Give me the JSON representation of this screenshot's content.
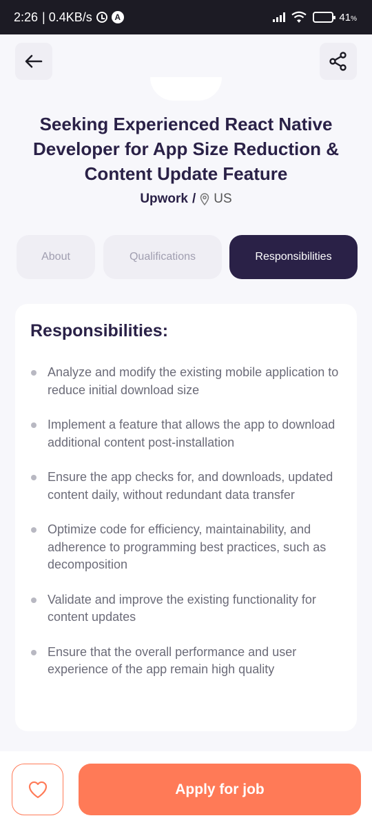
{
  "status_bar": {
    "time": "2:26",
    "network_speed": "| 0.4KB/s",
    "battery_percent": "41",
    "battery_symbol": "%",
    "battery_level": 0.41
  },
  "header": {
    "back_icon": "arrow-left-icon",
    "share_icon": "share-icon"
  },
  "job": {
    "title": "Seeking Experienced React Native Developer for App Size Reduction & Content Update Feature",
    "company": "Upwork",
    "separator": "/",
    "location": "US"
  },
  "tabs": [
    {
      "label": "About",
      "active": false
    },
    {
      "label": "Qualifications",
      "active": false
    },
    {
      "label": "Responsibilities",
      "active": true
    }
  ],
  "section": {
    "heading": "Responsibilities:",
    "items": [
      "Analyze and modify the existing mobile application to reduce initial download size",
      "Implement a feature that allows the app to download additional content post-installation",
      "Ensure the app checks for, and downloads, updated content daily, without redundant data transfer",
      "Optimize code for efficiency, maintainability, and adherence to programming best practices, such as decomposition",
      "Validate and improve the existing functionality for content updates",
      "Ensure that the overall performance and user experience of the app remain high quality"
    ]
  },
  "actions": {
    "favorite_icon": "heart-icon",
    "apply_label": "Apply for job"
  },
  "colors": {
    "primary_dark": "#2a2147",
    "accent": "#ff7a57"
  }
}
